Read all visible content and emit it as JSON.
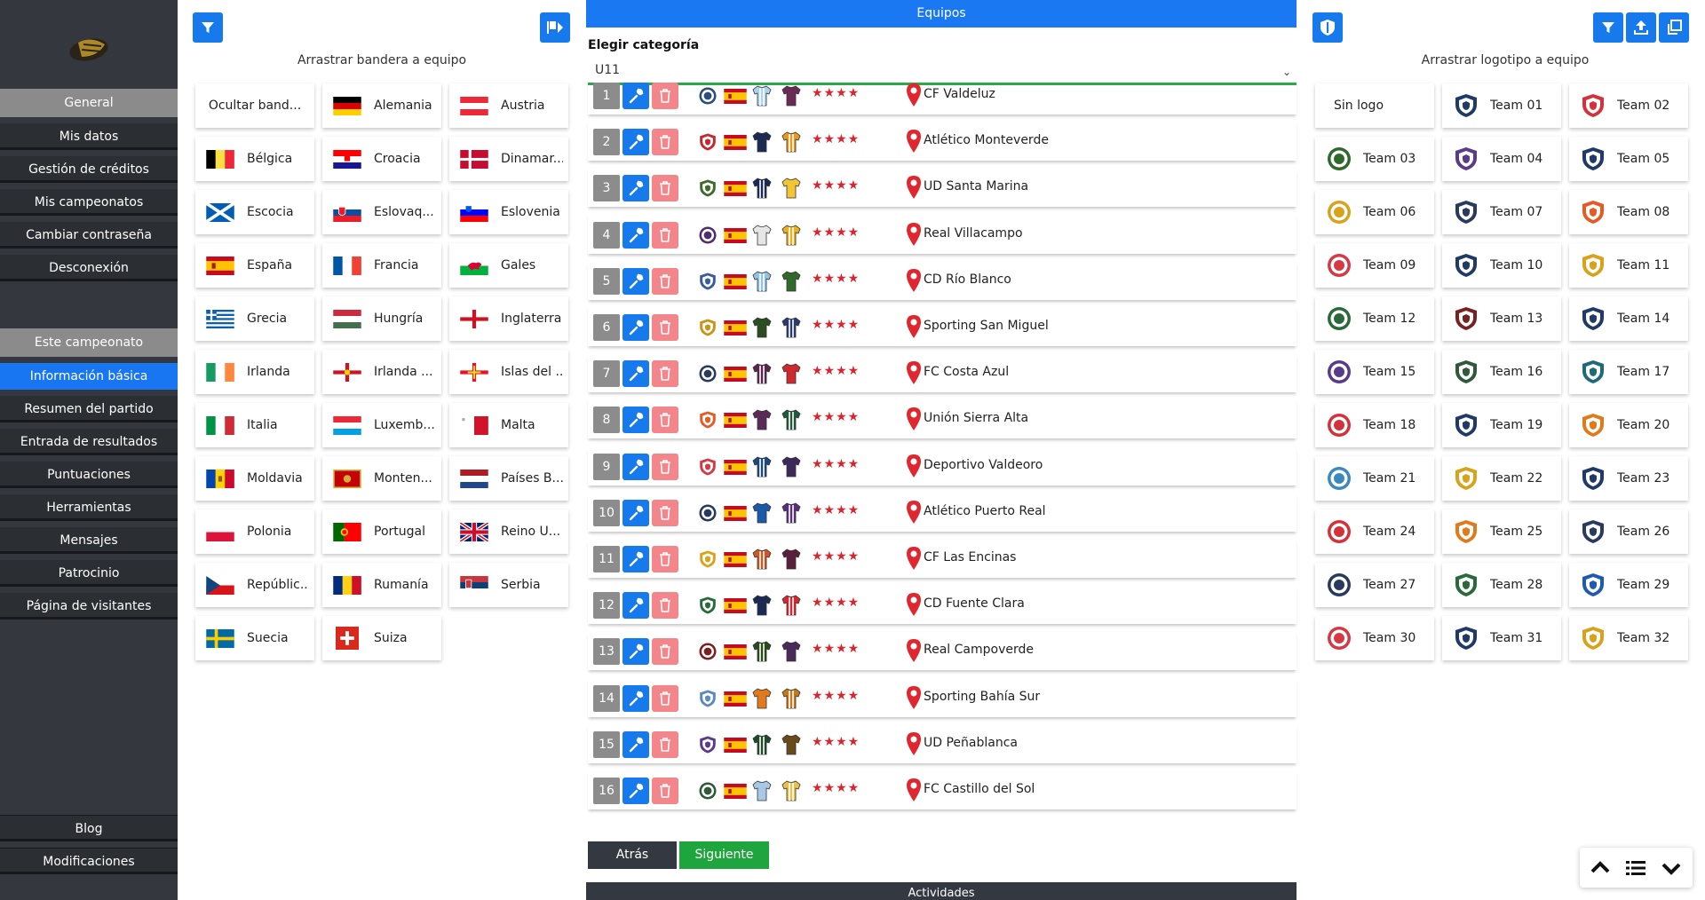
{
  "sidebar": {
    "general_header": "General",
    "general_items": [
      "Mis datos",
      "Gestión de créditos",
      "Mis campeonatos",
      "Cambiar contraseña",
      "Desconexión"
    ],
    "championship_header": "Este campeonato",
    "championship_items": [
      "Información básica",
      "Resumen del partido",
      "Entrada de resultados",
      "Puntuaciones",
      "Herramientas",
      "Mensajes",
      "Patrocinio",
      "Página de visitantes"
    ],
    "active_item": "Información básica",
    "bottom_items": [
      "Blog",
      "Modificaciones"
    ]
  },
  "flags_panel": {
    "drag_label": "Arrastrar bandera a equipo",
    "items": [
      {
        "label": "Ocultar band...",
        "flag": "none"
      },
      {
        "label": "Alemania",
        "flag": "de"
      },
      {
        "label": "Austria",
        "flag": "at"
      },
      {
        "label": "Bélgica",
        "flag": "be"
      },
      {
        "label": "Croacia",
        "flag": "hr"
      },
      {
        "label": "Dinamar...",
        "flag": "dk"
      },
      {
        "label": "Escocia",
        "flag": "sco"
      },
      {
        "label": "Eslovaq...",
        "flag": "sk"
      },
      {
        "label": "Eslovenia",
        "flag": "si"
      },
      {
        "label": "España",
        "flag": "es"
      },
      {
        "label": "Francia",
        "flag": "fr"
      },
      {
        "label": "Gales",
        "flag": "wal"
      },
      {
        "label": "Grecia",
        "flag": "gr"
      },
      {
        "label": "Hungría",
        "flag": "hu"
      },
      {
        "label": "Inglaterra",
        "flag": "eng"
      },
      {
        "label": "Irlanda",
        "flag": "ie"
      },
      {
        "label": "Irlanda ...",
        "flag": "nir"
      },
      {
        "label": "Islas del ...",
        "flag": "gg"
      },
      {
        "label": "Italia",
        "flag": "it"
      },
      {
        "label": "Luxemb...",
        "flag": "lu"
      },
      {
        "label": "Malta",
        "flag": "mt"
      },
      {
        "label": "Moldavia",
        "flag": "md"
      },
      {
        "label": "Monten...",
        "flag": "me"
      },
      {
        "label": "Países B...",
        "flag": "nl"
      },
      {
        "label": "Polonia",
        "flag": "pl"
      },
      {
        "label": "Portugal",
        "flag": "pt"
      },
      {
        "label": "Reino U...",
        "flag": "gb"
      },
      {
        "label": "Repúblic...",
        "flag": "cz"
      },
      {
        "label": "Rumanía",
        "flag": "ro"
      },
      {
        "label": "Serbia",
        "flag": "rs"
      },
      {
        "label": "Suecia",
        "flag": "se"
      },
      {
        "label": "Suiza",
        "flag": "ch"
      }
    ]
  },
  "teams": {
    "header": "Equipos",
    "category_label": "Elegir categoría",
    "category_value": "U11",
    "rating": "★★★★",
    "rows": [
      {
        "number": "1",
        "name": "CF Valdeluz",
        "logo_color": "#2b4d7e",
        "shirt1": "#a9d3ef",
        "shirt2": "#6b2a55"
      },
      {
        "number": "2",
        "name": "Atlético Monteverde",
        "logo_color": "#c8262e",
        "shirt1": "#1a2a55",
        "shirt2": "#e79a1e"
      },
      {
        "number": "3",
        "name": "UD Santa Marina",
        "logo_color": "#3f6b2a",
        "shirt1": "#1a2a55",
        "shirt2": "#f2c537"
      },
      {
        "number": "4",
        "name": "Real Villacampo",
        "logo_color": "#4d2f6e",
        "shirt1": "#e6e6e6",
        "shirt2": "#e8b021"
      },
      {
        "number": "5",
        "name": "CD Río Blanco",
        "logo_color": "#3a5c9a",
        "shirt1": "#8fc3e8",
        "shirt2": "#2f6a2b"
      },
      {
        "number": "6",
        "name": "Sporting San Miguel",
        "logo_color": "#c99418",
        "shirt1": "#2b4d1f",
        "shirt2": "#2a3c6f"
      },
      {
        "number": "7",
        "name": "FC Costa Azul",
        "logo_color": "#2a3a5e",
        "shirt1": "#5a2450",
        "shirt2": "#cc2a2f"
      },
      {
        "number": "8",
        "name": "Unión Sierra Alta",
        "logo_color": "#e65a23",
        "shirt1": "#5b2a58",
        "shirt2": "#1f5a3a"
      },
      {
        "number": "9",
        "name": "Deportivo Valdeoro",
        "logo_color": "#d43a44",
        "shirt1": "#1a4a7a",
        "shirt2": "#3c2a5a"
      },
      {
        "number": "10",
        "name": "Atlético Puerto Real",
        "logo_color": "#2a3a5e",
        "shirt1": "#1a5aa8",
        "shirt2": "#5a2f7a"
      },
      {
        "number": "11",
        "name": "CF Las Encinas",
        "logo_color": "#d9a21b",
        "shirt1": "#d4561e",
        "shirt2": "#5a1f3a"
      },
      {
        "number": "12",
        "name": "CD Fuente Clara",
        "logo_color": "#2a6a3a",
        "shirt1": "#1a2a55",
        "shirt2": "#d8262e"
      },
      {
        "number": "13",
        "name": "Real Campoverde",
        "logo_color": "#7a2020",
        "shirt1": "#2a4a1a",
        "shirt2": "#4a2a5a"
      },
      {
        "number": "14",
        "name": "Sporting Bahía Sur",
        "logo_color": "#5a8ac0",
        "shirt1": "#e07a1a",
        "shirt2": "#c4781a"
      },
      {
        "number": "15",
        "name": "UD Peñablanca",
        "logo_color": "#5a3a8a",
        "shirt1": "#1f4a2a",
        "shirt2": "#6a4a1a"
      },
      {
        "number": "16",
        "name": "FC Castillo del Sol",
        "logo_color": "#2f5a3a",
        "shirt1": "#a8c8e8",
        "shirt2": "#e8c24a"
      }
    ],
    "back_label": "Atrás",
    "next_label": "Siguiente",
    "activities_label": "Actividades"
  },
  "logos_panel": {
    "drag_label": "Arrastrar logotipo a equipo",
    "items": [
      {
        "label": "Sin logo",
        "color": ""
      },
      {
        "label": "Team 01",
        "color": "#1f3a66"
      },
      {
        "label": "Team 02",
        "color": "#d2323a"
      },
      {
        "label": "Team 03",
        "color": "#2f6a2b"
      },
      {
        "label": "Team 04",
        "color": "#5a3a8a"
      },
      {
        "label": "Team 05",
        "color": "#1f3a66"
      },
      {
        "label": "Team 06",
        "color": "#d9a21b"
      },
      {
        "label": "Team 07",
        "color": "#2a3a5e"
      },
      {
        "label": "Team 08",
        "color": "#e65a23"
      },
      {
        "label": "Team 09",
        "color": "#d43a44"
      },
      {
        "label": "Team 10",
        "color": "#1f3a66"
      },
      {
        "label": "Team 11",
        "color": "#d9a21b"
      },
      {
        "label": "Team 12",
        "color": "#2a6a3a"
      },
      {
        "label": "Team 13",
        "color": "#7a2020"
      },
      {
        "label": "Team 14",
        "color": "#1f3a66"
      },
      {
        "label": "Team 15",
        "color": "#5a3a8a"
      },
      {
        "label": "Team 16",
        "color": "#2f5a3a"
      },
      {
        "label": "Team 17",
        "color": "#1f6a7a"
      },
      {
        "label": "Team 18",
        "color": "#d2323a"
      },
      {
        "label": "Team 19",
        "color": "#1f3a66"
      },
      {
        "label": "Team 20",
        "color": "#e07a1a"
      },
      {
        "label": "Team 21",
        "color": "#3a8ac0"
      },
      {
        "label": "Team 22",
        "color": "#d9a21b"
      },
      {
        "label": "Team 23",
        "color": "#1f3a66"
      },
      {
        "label": "Team 24",
        "color": "#d2323a"
      },
      {
        "label": "Team 25",
        "color": "#e07a1a"
      },
      {
        "label": "Team 26",
        "color": "#2a3a5e"
      },
      {
        "label": "Team 27",
        "color": "#2a3a5e"
      },
      {
        "label": "Team 28",
        "color": "#2a6a3a"
      },
      {
        "label": "Team 29",
        "color": "#1f5ab0"
      },
      {
        "label": "Team 30",
        "color": "#d43a44"
      },
      {
        "label": "Team 31",
        "color": "#1f3a66"
      },
      {
        "label": "Team 32",
        "color": "#d9a21b"
      }
    ]
  },
  "colors": {
    "accent": "#1679ec",
    "sidebar_bg": "#34373d",
    "delete": "#f2868a",
    "success": "#2aa84a",
    "stars": "#d7262f"
  }
}
